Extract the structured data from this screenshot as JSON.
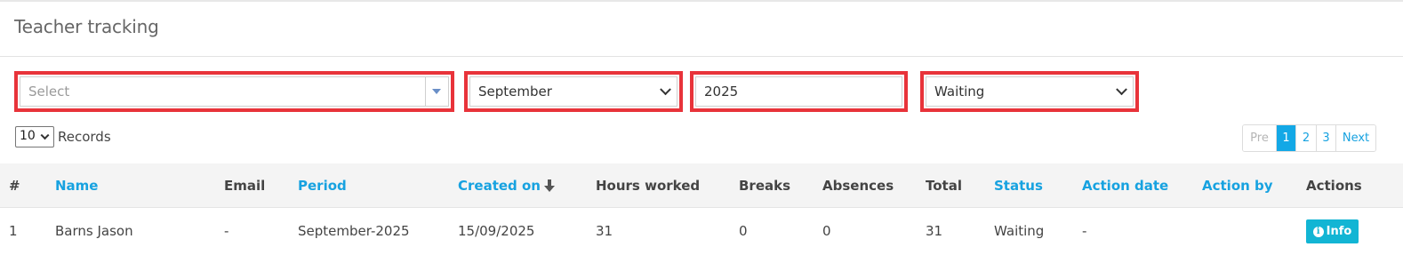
{
  "page": {
    "title": "Teacher tracking"
  },
  "filters": {
    "teacher_select": {
      "placeholder": "Select"
    },
    "month_select": {
      "value": "September"
    },
    "year_input": {
      "value": "2025"
    },
    "status_select": {
      "value": "Waiting"
    }
  },
  "records": {
    "value": "10",
    "label": "Records"
  },
  "pagination": {
    "prev": "Pre",
    "pages": [
      "1",
      "2",
      "3"
    ],
    "active_page": "1",
    "next": "Next"
  },
  "table": {
    "headers": {
      "index": "#",
      "name": "Name",
      "email": "Email",
      "period": "Period",
      "created_on": "Created on",
      "hours_worked": "Hours worked",
      "breaks": "Breaks",
      "absences": "Absences",
      "total": "Total",
      "status": "Status",
      "action_date": "Action date",
      "action_by": "Action by",
      "actions": "Actions"
    },
    "rows": [
      {
        "index": "1",
        "name": "Barns Jason",
        "email": "-",
        "period": "September-2025",
        "created_on": "15/09/2025",
        "hours_worked": "31",
        "breaks": "0",
        "absences": "0",
        "total": "31",
        "status": "Waiting",
        "action_date": "-",
        "action_by": "",
        "action_label": "Info"
      }
    ]
  },
  "colors": {
    "accent": "#17a2e0",
    "highlight": "#e8333a",
    "info_button": "#12b5d4"
  },
  "icons": {
    "sort": "arrow-down-icon",
    "info": "info-circle-icon",
    "dropdown": "chevron-down-icon"
  }
}
